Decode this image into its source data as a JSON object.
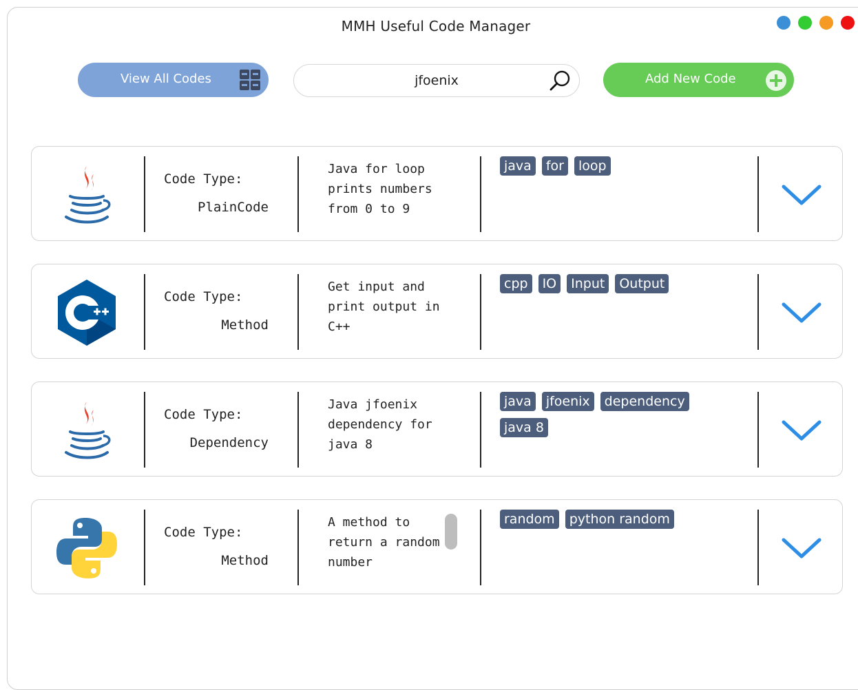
{
  "window": {
    "title": "MMH Useful Code Manager",
    "controls": [
      {
        "name": "blue-dot",
        "color": "#3b8fd6"
      },
      {
        "name": "green-dot",
        "color": "#33cc33"
      },
      {
        "name": "orange-dot",
        "color": "#f59a23"
      },
      {
        "name": "red-dot",
        "color": "#ee1111"
      }
    ]
  },
  "toolbar": {
    "view_all_label": "View All Codes",
    "view_all_icon": "grid-icon",
    "search_value": "jfoenix",
    "search_icon": "search-icon",
    "add_label": "Add New Code",
    "add_icon": "plus-circle-icon"
  },
  "colors": {
    "view_button": "#7ea3d9",
    "add_button": "#66cc55",
    "tag_bg": "#4c5e7c",
    "chevron": "#2e8ee6"
  },
  "codes": [
    {
      "language_icon": "java-icon",
      "type_label": "Code Type:",
      "type_value": "PlainCode",
      "description": "Java for loop prints numbers from 0 to 9",
      "tags": [
        "java",
        "for",
        "loop"
      ]
    },
    {
      "language_icon": "cpp-icon",
      "type_label": "Code Type:",
      "type_value": "Method",
      "description": "Get input and print output in C++",
      "tags": [
        "cpp",
        "IO",
        "Input",
        "Output"
      ]
    },
    {
      "language_icon": "java-icon",
      "type_label": "Code Type:",
      "type_value": "Dependency",
      "description": "Java jfoenix dependency for java 8",
      "tags": [
        "java",
        "jfoenix",
        "dependency",
        "java 8"
      ]
    },
    {
      "language_icon": "python-icon",
      "type_label": "Code Type:",
      "type_value": "Method",
      "description": "A method to return a random number",
      "tags": [
        "random",
        "python random"
      ]
    }
  ]
}
